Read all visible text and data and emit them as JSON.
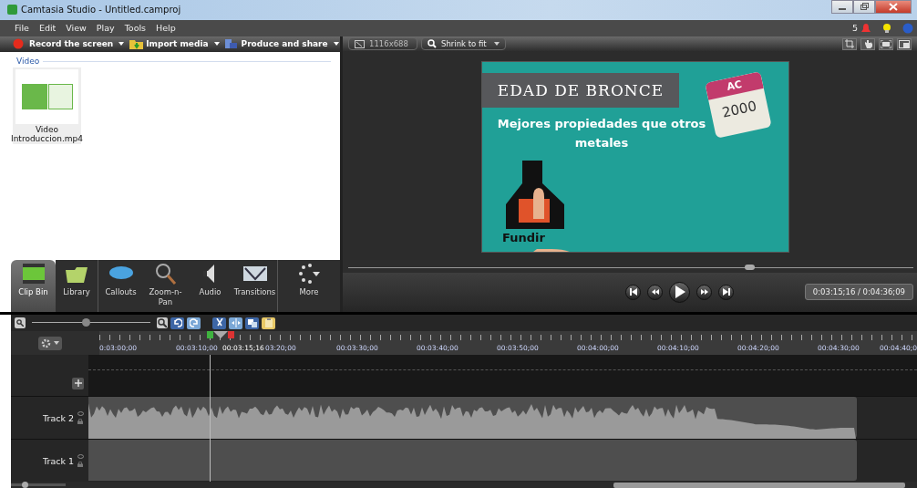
{
  "window": {
    "title": "Camtasia Studio - Untitled.camproj"
  },
  "menu": [
    "File",
    "Edit",
    "View",
    "Play",
    "Tools",
    "Help"
  ],
  "notifications": {
    "count": "5"
  },
  "toolbar": [
    {
      "label": "Record the screen",
      "kind": "record"
    },
    {
      "label": "Import media",
      "kind": "import"
    },
    {
      "label": "Produce and share",
      "kind": "produce"
    }
  ],
  "preview_toolbar": {
    "dimensions": "1116x688",
    "zoom": "Shrink to fit"
  },
  "clip_bin": {
    "section": "Video",
    "clips": [
      {
        "name": "Video Introduccion.mp4"
      }
    ]
  },
  "preview": {
    "heading": "EDAD DE BRONCE",
    "subtitle": "Mejores propiedades que otros metales",
    "calendar_top": "AC",
    "calendar_year": "2000",
    "caption": "Fundir"
  },
  "tabs": [
    {
      "label": "Clip Bin",
      "kind": "clipbin",
      "selected": true
    },
    {
      "label": "Library",
      "kind": "library",
      "selected": false
    },
    {
      "label": "Callouts",
      "kind": "callouts",
      "selected": false
    },
    {
      "label": "Zoom-n-Pan",
      "kind": "zoom",
      "selected": false
    },
    {
      "label": "Audio",
      "kind": "audio",
      "selected": false
    },
    {
      "label": "Transitions",
      "kind": "transitions",
      "selected": false
    },
    {
      "label": "More",
      "kind": "more",
      "selected": false
    }
  ],
  "player": {
    "level": 0.71,
    "time": "0:03:15;16 / 0:04:36;09"
  },
  "zoom_slider": {
    "level": 0.45
  },
  "track_height_slider": {
    "level": 0.25
  },
  "timeline": {
    "playhead": "00:03:15;16",
    "ruler": [
      "0:03:00;00",
      "00:03:10;00",
      "03:20;00",
      "00:03:30;00",
      "00:03:40;00",
      "00:03:50;00",
      "00:04:00;00",
      "00:04:10;00",
      "00:04:20;00",
      "00:04:30;00",
      "00:04:40;0"
    ],
    "tracks": [
      {
        "name": "Track 2",
        "kind": "audio"
      },
      {
        "name": "Track 1",
        "kind": "empty"
      }
    ]
  }
}
